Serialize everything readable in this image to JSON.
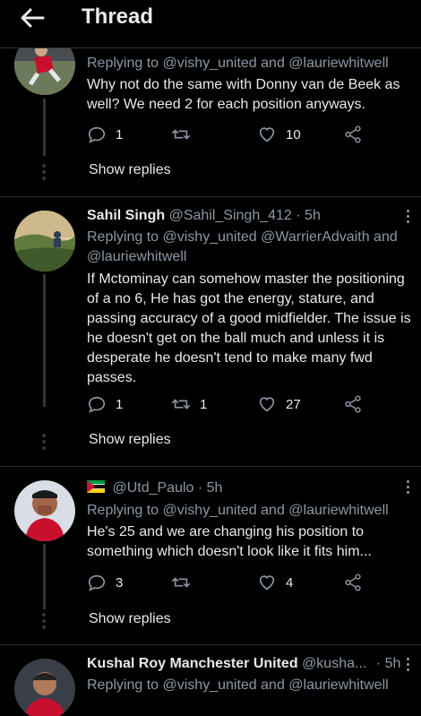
{
  "header": {
    "title": "Thread"
  },
  "common": {
    "show_replies": "Show replies",
    "replying_to": "Replying to",
    "and": "and"
  },
  "tweets": [
    {
      "reply_handles": [
        "@vishy_united",
        "@lauriewhitwell"
      ],
      "text": [
        "Why not do the same with Donny van de Beek as",
        "well? We need 2 for each position anyways."
      ],
      "stats": {
        "replies": "1",
        "retweets": "",
        "likes": "10"
      }
    },
    {
      "name": "Sahil Singh",
      "handle": "@Sahil_Singh_412",
      "time": "· 5h",
      "reply_handles": [
        "@vishy_united",
        "@WarrierAdvaith",
        "@lauriewhitwell"
      ],
      "text": [
        "If Mctominay can somehow master the positioning",
        "of a no 6, He has got the energy, stature, and",
        "passing accuracy of a good midfielder. The issue is",
        "he doesn't get on the ball much and unless it is",
        "desperate he doesn't tend to make many fwd",
        "passes."
      ],
      "stats": {
        "replies": "1",
        "retweets": "1",
        "likes": "27"
      }
    },
    {
      "handle": "@Utd_Paulo",
      "time": "· 5h",
      "reply_handles": [
        "@vishy_united",
        "@lauriewhitwell"
      ],
      "text": [
        "He's 25 and we are changing his position to",
        "something which doesn't look like it fits him..."
      ],
      "stats": {
        "replies": "3",
        "retweets": "",
        "likes": "4"
      }
    },
    {
      "name": "Kushal Roy Manchester United",
      "handle": "@kusha...",
      "time": "· 5h",
      "reply_handles": [
        "@vishy_united",
        "@lauriewhitwell"
      ]
    }
  ]
}
